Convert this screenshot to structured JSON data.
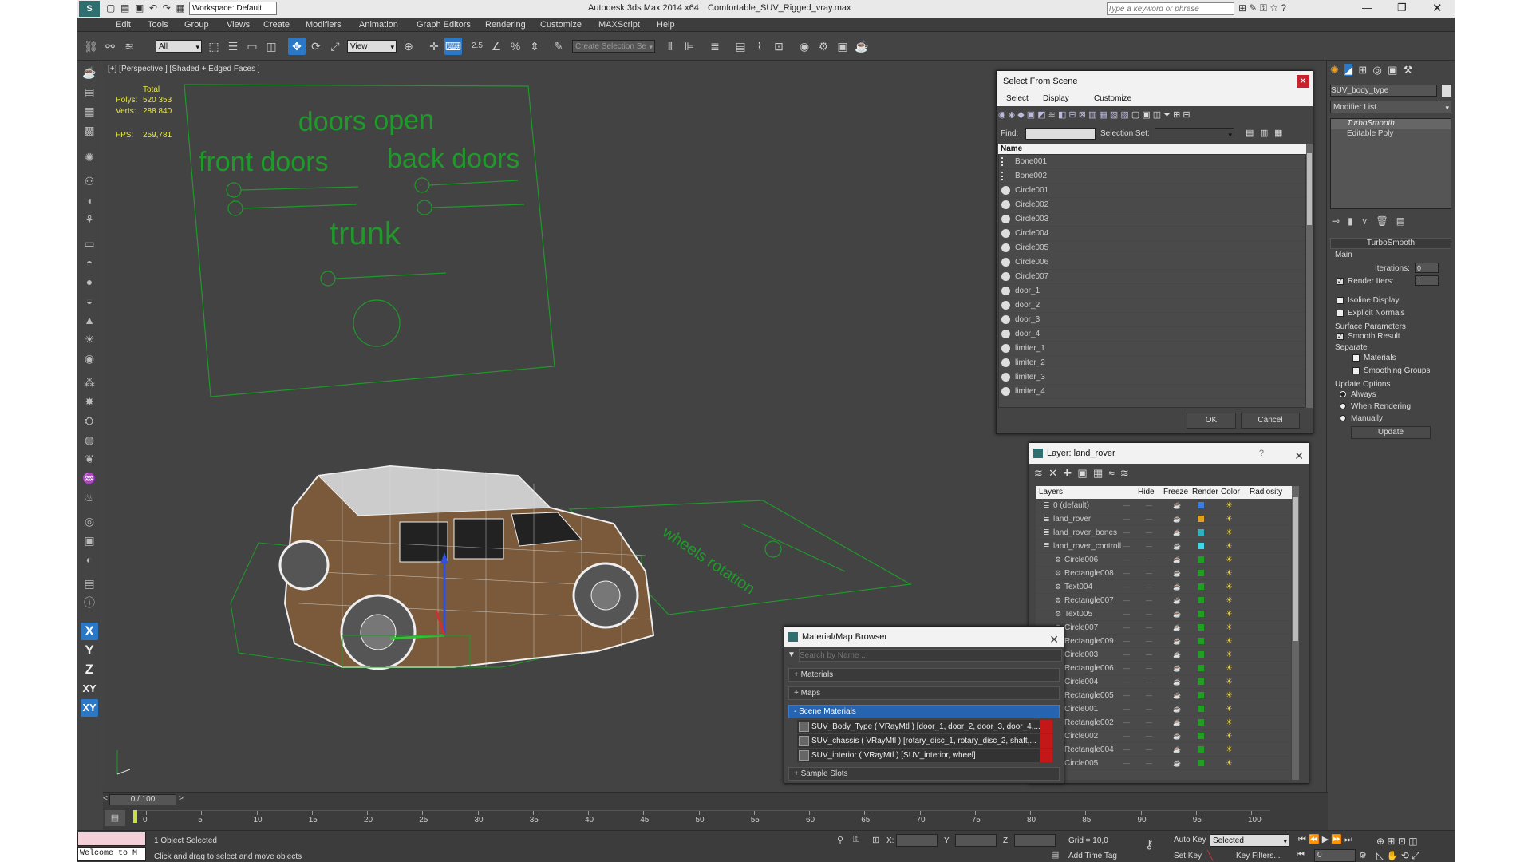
{
  "app": {
    "title": "Autodesk 3ds Max  2014 x64",
    "file": "Comfortable_SUV_Rigged_vray.max",
    "workspace": "Workspace: Default",
    "search_placeholder": "Type a keyword or phrase"
  },
  "menu": [
    "Edit",
    "Tools",
    "Group",
    "Views",
    "Create",
    "Modifiers",
    "Animation",
    "Graph Editors",
    "Rendering",
    "Customize",
    "MAXScript",
    "Help"
  ],
  "toolbar": {
    "filter": "All",
    "refcoord": "View",
    "selection_set": "Create Selection Se",
    "snap": "2.5"
  },
  "viewport": {
    "label": "[+] [Perspective ] [Shaded + Edged Faces ]",
    "stats": {
      "total": "Total",
      "polys_label": "Polys:",
      "polys": "520 353",
      "verts_label": "Verts:",
      "verts": "288 840",
      "fps_label": "FPS:",
      "fps": "259,781"
    },
    "panel": {
      "doors_open": "doors open",
      "front_doors": "front doors",
      "back_doors": "back doors",
      "trunk": "trunk",
      "wheels_rotation": "wheels rotation"
    }
  },
  "select_dialog": {
    "title": "Select From Scene",
    "menu": [
      "Select",
      "Display",
      "Customize"
    ],
    "find_label": "Find:",
    "selection_set_label": "Selection Set:",
    "column": "Name",
    "items": [
      "Bone001",
      "Bone002",
      "Circle001",
      "Circle002",
      "Circle003",
      "Circle004",
      "Circle005",
      "Circle006",
      "Circle007",
      "door_1",
      "door_2",
      "door_3",
      "door_4",
      "limiter_1",
      "limiter_2",
      "limiter_3",
      "limiter_4"
    ],
    "ok": "OK",
    "cancel": "Cancel"
  },
  "layer_dialog": {
    "title": "Layer: land_rover",
    "help": "?",
    "columns": [
      "Layers",
      "Hide",
      "Freeze",
      "Render",
      "Color",
      "Radiosity"
    ],
    "layers": [
      {
        "name": "0 (default)",
        "color": "#3a7de0",
        "indent": 0
      },
      {
        "name": "land_rover",
        "color": "#e0a020",
        "indent": 0
      },
      {
        "name": "land_rover_bones",
        "color": "#30b0c0",
        "indent": 0
      },
      {
        "name": "land_rover_controll",
        "color": "#40d8e8",
        "indent": 0
      },
      {
        "name": "Circle006",
        "color": "#20a020",
        "indent": 1
      },
      {
        "name": "Rectangle008",
        "color": "#20a020",
        "indent": 1
      },
      {
        "name": "Text004",
        "color": "#20a020",
        "indent": 1
      },
      {
        "name": "Rectangle007",
        "color": "#20a020",
        "indent": 1
      },
      {
        "name": "Text005",
        "color": "#20a020",
        "indent": 1
      },
      {
        "name": "Circle007",
        "color": "#20a020",
        "indent": 1
      },
      {
        "name": "Rectangle009",
        "color": "#20a020",
        "indent": 1
      },
      {
        "name": "Circle003",
        "color": "#20a020",
        "indent": 1
      },
      {
        "name": "Rectangle006",
        "color": "#20a020",
        "indent": 1
      },
      {
        "name": "Circle004",
        "color": "#20a020",
        "indent": 1
      },
      {
        "name": "Rectangle005",
        "color": "#20a020",
        "indent": 1
      },
      {
        "name": "Circle001",
        "color": "#20a020",
        "indent": 1
      },
      {
        "name": "Rectangle002",
        "color": "#20a020",
        "indent": 1
      },
      {
        "name": "Circle002",
        "color": "#20a020",
        "indent": 1
      },
      {
        "name": "Rectangle004",
        "color": "#20a020",
        "indent": 1
      },
      {
        "name": "Circle005",
        "color": "#20a020",
        "indent": 1
      }
    ]
  },
  "material_browser": {
    "title": "Material/Map Browser",
    "search_placeholder": "Search by Name ...",
    "sections": [
      "+ Materials",
      "+ Maps",
      "- Scene Materials",
      "+ Sample Slots"
    ],
    "scene_materials": [
      "SUV_Body_Type ( VRayMtl ) [door_1, door_2, door_3, door_4,...",
      "SUV_chassis ( VRayMtl ) [rotary_disc_1, rotary_disc_2, shaft,...",
      "SUV_interior ( VRayMtl ) [SUV_interior, wheel]"
    ]
  },
  "command_panel": {
    "object_name": "SUV_body_type",
    "modifier_list": "Modifier List",
    "stack": [
      "TurboSmooth",
      "Editable Poly"
    ],
    "turbosmooth": {
      "title": "TurboSmooth",
      "main": "Main",
      "iterations_label": "Iterations:",
      "iterations": "0",
      "render_iters_label": "Render Iters:",
      "render_iters": "1",
      "isoline": "Isoline Display",
      "explicit_normals": "Explicit Normals",
      "surface_params": "Surface Parameters",
      "smooth_result": "Smooth Result",
      "separate": "Separate",
      "materials": "Materials",
      "smoothing_groups": "Smoothing Groups",
      "update_options": "Update Options",
      "always": "Always",
      "when_rendering": "When Rendering",
      "manually": "Manually",
      "update": "Update"
    }
  },
  "timeline": {
    "frame": "0 / 100",
    "ticks": [
      "0",
      "5",
      "10",
      "15",
      "20",
      "25",
      "30",
      "35",
      "40",
      "45",
      "50",
      "55",
      "60",
      "65",
      "70",
      "75",
      "80",
      "85",
      "90",
      "95",
      "100"
    ]
  },
  "status": {
    "selected": "1 Object Selected",
    "prompt": "Click and drag to select and move objects",
    "welcome": "Welcome to M",
    "x_label": "X:",
    "y_label": "Y:",
    "z_label": "Z:",
    "grid": "Grid = 10,0",
    "auto_key": "Auto Key",
    "set_key": "Set Key",
    "key_mode": "Selected",
    "key_filters": "Key Filters...",
    "add_time_tag": "Add Time Tag",
    "frame_value": "0"
  },
  "axis_buttons": [
    "X",
    "Y",
    "Z",
    "XY",
    "XY"
  ]
}
